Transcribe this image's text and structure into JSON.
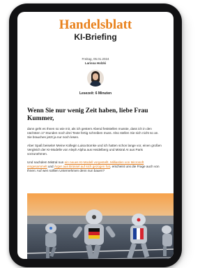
{
  "brand": {
    "name": "Handelsblatt",
    "newsletter": "KI-Briefing",
    "brand_color": "#e8801a"
  },
  "meta": {
    "date_line": "Freitag, 05.01.2024",
    "author": "Larissa Holzki"
  },
  "reading_time": "Lesezeit: 6 Minuten",
  "headline": "Wenn Sie nur wenig Zeit haben, liebe Frau Kummer,",
  "paragraphs": {
    "p1": "dann geht es Ihnen so wie mir, als ich gestern Abend feststellen musste, dass ich in den nächsten 17 Stunden noch drei Texte fertig schreiben muss. Also stellen Sie sich nicht so an. Sie brauchen jetzt ja nur noch lesen.",
    "p2": "Aber Spaß beiseite! Meine Kollegin Luisa Bomke und ich hatten schon lange vor, einen großen Vergleich der KI-Modelle von Aleph Alpha aus Heidelberg und Mistral AI aus Paris vorzunehmen.",
    "p3_before": "Und nachdem Mistral nun ",
    "p3_link1": "ein neues KI-Modell vorgestellt, Milliarden von Microsoft eingesammelt",
    "p3_mid": " und ",
    "p3_link2": "Ärger aus Brüssel auf sich gezogen hat",
    "p3_after": ", erscheint uns die Frage auch von Ihnen: Auf wen sollten Unternehmen denn nun bauen?"
  }
}
